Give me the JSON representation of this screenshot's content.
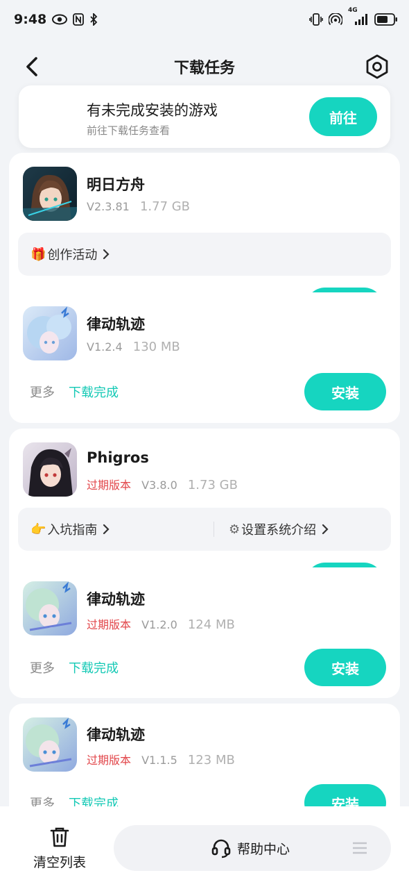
{
  "status_bar": {
    "time": "9:48",
    "icons_left": [
      "eye-icon",
      "nfc-icon",
      "bluetooth-icon"
    ],
    "icons_right": [
      "vibrate-icon",
      "hotspot-icon",
      "signal-4g-icon",
      "battery-icon"
    ],
    "network": "4G"
  },
  "header": {
    "title": "下载任务",
    "back_icon": "chevron-left-icon",
    "settings_icon": "hexagon-gear-icon"
  },
  "banner": {
    "title": "有未完成安装的游戏",
    "subtitle": "前往下载任务查看",
    "button": "前往"
  },
  "groups": [
    {
      "parent": {
        "name": "明日方舟",
        "version": "V2.3.81",
        "size": "1.77 GB"
      },
      "links": [
        {
          "emoji": "🎁",
          "label": "创作活动"
        }
      ],
      "child": {
        "name": "律动轨迹",
        "version": "V1.2.4",
        "size": "130 MB",
        "more": "更多",
        "status": "下载完成",
        "button": "安装"
      }
    },
    {
      "parent": {
        "name": "Phigros",
        "expired": "过期版本",
        "version": "V3.8.0",
        "size": "1.73 GB"
      },
      "links": [
        {
          "emoji": "👉",
          "label": "入坑指南"
        },
        {
          "emoji": "⚙",
          "label": "设置系统介绍"
        }
      ],
      "child": {
        "name": "律动轨迹",
        "expired": "过期版本",
        "version": "V1.2.0",
        "size": "124 MB",
        "more": "更多",
        "status": "下载完成",
        "button": "安装"
      }
    },
    {
      "child": {
        "name": "律动轨迹",
        "expired": "过期版本",
        "version": "V1.1.5",
        "size": "123 MB",
        "more": "更多",
        "status": "下载完成",
        "button": "安装"
      }
    }
  ],
  "bottom_bar": {
    "clear_label": "清空列表",
    "help_label": "帮助中心"
  },
  "colors": {
    "accent": "#16d5c0",
    "accent_text": "#14c9b5",
    "expired": "#e2474b",
    "background": "#f2f4f7"
  }
}
